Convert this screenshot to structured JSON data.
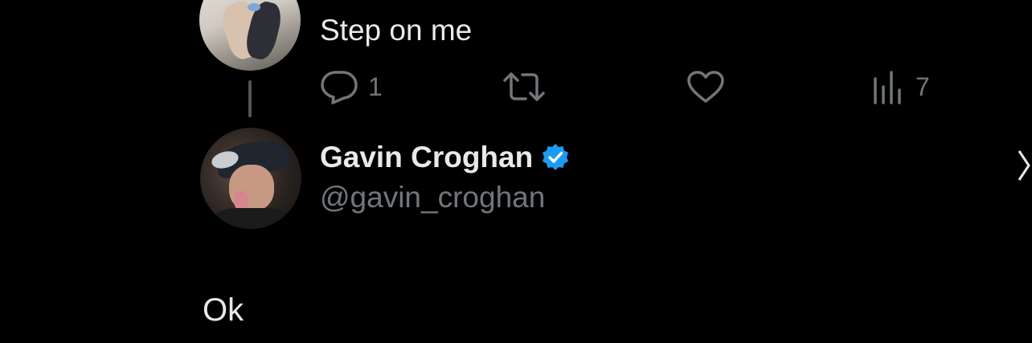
{
  "parent_tweet": {
    "text": "Step on me",
    "actions": {
      "reply": {
        "icon": "reply-icon",
        "count": "1"
      },
      "retweet": {
        "icon": "retweet-icon",
        "count": ""
      },
      "like": {
        "icon": "heart-icon",
        "count": ""
      },
      "views": {
        "icon": "views-icon",
        "count": "7"
      }
    }
  },
  "reply_tweet": {
    "author_name": "Gavin Croghan",
    "handle": "@gavin_croghan",
    "verified": true,
    "text": "Ok"
  },
  "colors": {
    "background": "#000000",
    "primary_text": "#e7e9ea",
    "secondary_text": "#71767b",
    "verified_badge": "#1d9bf0",
    "thread_line": "#505457"
  }
}
